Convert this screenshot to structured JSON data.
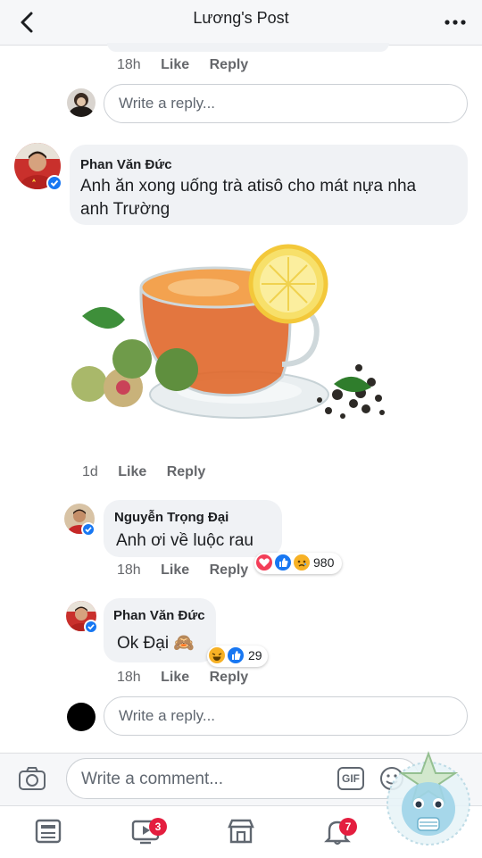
{
  "header": {
    "title": "Lương's Post"
  },
  "thread": {
    "prev_meta": {
      "time": "18h",
      "like": "Like",
      "reply": "Reply"
    },
    "reply_box_1": {
      "placeholder": "Write a reply..."
    },
    "main_comment": {
      "author": "Phan Văn Đức",
      "text_line1": "Anh ăn xong uống trà atisô cho mát nựa nha",
      "text_line2": "anh Trường",
      "image_alt": "tea-cup-with-lemon-and-artichoke",
      "time": "1d",
      "like": "Like",
      "reply": "Reply"
    },
    "replies": [
      {
        "author": "Nguyễn Trọng Đại",
        "text": "Anh ơi về luộc rau",
        "time": "18h",
        "like": "Like",
        "reply": "Reply",
        "reactions": [
          "love",
          "like",
          "sad"
        ],
        "reaction_count": "980"
      },
      {
        "author": "Phan Văn Đức",
        "text": "Ok Đại 🙈",
        "time": "18h",
        "like": "Like",
        "reply": "Reply",
        "reactions": [
          "haha",
          "like"
        ],
        "reaction_count": "29"
      }
    ],
    "reply_box_2": {
      "placeholder": "Write a reply..."
    }
  },
  "composer": {
    "placeholder": "Write a comment...",
    "gif_label": "GIF"
  },
  "tabbar": {
    "items": [
      {
        "icon": "news-feed-icon"
      },
      {
        "icon": "watch-icon",
        "badge": "3"
      },
      {
        "icon": "marketplace-icon"
      },
      {
        "icon": "notifications-icon",
        "badge": "7"
      }
    ]
  },
  "colors": {
    "accent": "#1877f2",
    "badge": "#e41e3f",
    "bubble": "#f0f2f5"
  }
}
